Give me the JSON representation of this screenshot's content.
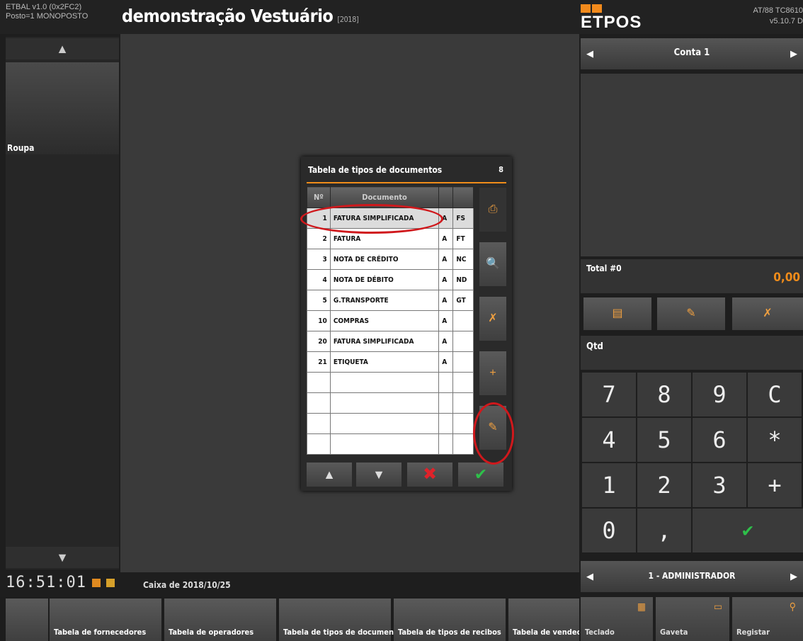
{
  "header": {
    "version_line1": "ETBAL v1.0 (0x2FC2)",
    "version_line2": "Posto=1 MONOPOSTO",
    "title": "demonstração Vestuário",
    "year": "[2018]",
    "logo_text": "ETPOS",
    "right_line1": "AT/88 TC8610",
    "right_line2": "v5.10.7 D"
  },
  "left": {
    "up_arrow": "▲",
    "category": "Roupa",
    "down_arrow": "▼"
  },
  "status": {
    "clock": "16:51:01",
    "caixa": "Caixa de 2018/10/25"
  },
  "bottom_tabs": [
    "Tabela de fornecedores",
    "Tabela de operadores",
    "Tabela de tipos de documentos",
    "Tabela de tipos de recibos",
    "Tabela de vendedore"
  ],
  "right": {
    "conta": "Conta 1",
    "total_label": "Total #0",
    "total_value": "0,00",
    "qtd_label": "Qtd",
    "keys": [
      "7",
      "8",
      "9",
      "C",
      "4",
      "5",
      "6",
      "*",
      "1",
      "2",
      "3",
      "+",
      "0",
      ",",
      "✔"
    ],
    "user": "1 - ADMINISTRADOR",
    "buttons": [
      "Teclado",
      "Gaveta",
      "Registar"
    ]
  },
  "dialog": {
    "title": "Tabela de tipos de documentos",
    "count": "8",
    "col_num": "Nº",
    "col_doc": "Documento",
    "rows": [
      {
        "n": "1",
        "doc": "FATURA SIMPLIFICADA",
        "s": "A",
        "c": "FS"
      },
      {
        "n": "2",
        "doc": "FATURA",
        "s": "A",
        "c": "FT"
      },
      {
        "n": "3",
        "doc": "NOTA DE CRÉDITO",
        "s": "A",
        "c": "NC"
      },
      {
        "n": "4",
        "doc": "NOTA DE DÉBITO",
        "s": "A",
        "c": "ND"
      },
      {
        "n": "5",
        "doc": "G.TRANSPORTE",
        "s": "A",
        "c": "GT"
      },
      {
        "n": "10",
        "doc": "COMPRAS",
        "s": "A",
        "c": ""
      },
      {
        "n": "20",
        "doc": "FATURA SIMPLIFICADA",
        "s": "A",
        "c": ""
      },
      {
        "n": "21",
        "doc": "ETIQUETA",
        "s": "A",
        "c": ""
      }
    ]
  },
  "colors": {
    "accent": "#f08c1a",
    "highlight_ring": "#d0181c",
    "confirm": "#2ec04a",
    "cancel": "#e0222a"
  }
}
